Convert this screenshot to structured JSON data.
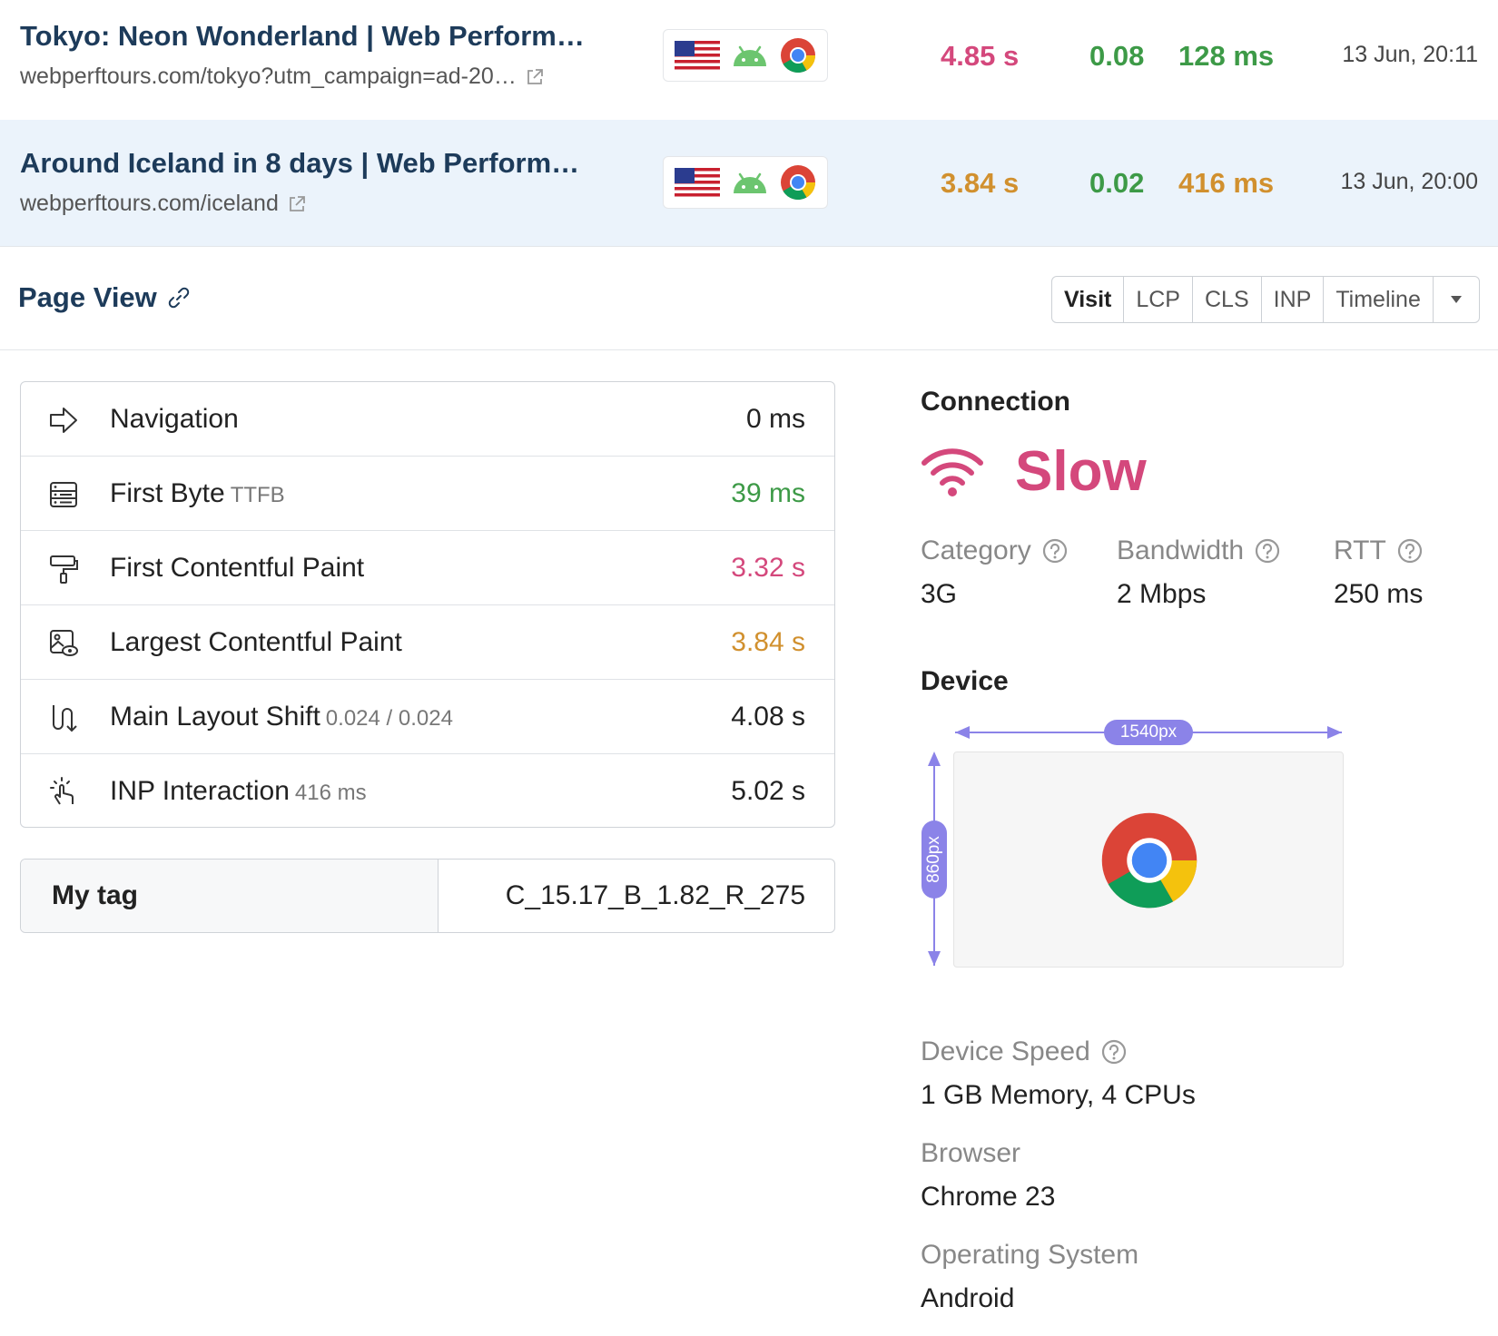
{
  "rows": [
    {
      "title": "Tokyo: Neon Wonderland | Web Perform…",
      "url": "webperftours.com/tokyo?utm_campaign=ad-20…",
      "lcp": "4.85 s",
      "cls": "0.08",
      "inp": "128 ms",
      "date": "13 Jun, 20:11"
    },
    {
      "title": "Around Iceland in 8 days | Web Perform…",
      "url": "webperftours.com/iceland",
      "lcp": "3.84 s",
      "cls": "0.02",
      "inp": "416 ms",
      "date": "13 Jun, 20:00"
    }
  ],
  "page_view": {
    "title": "Page View",
    "tabs": [
      "Visit",
      "LCP",
      "CLS",
      "INP",
      "Timeline"
    ]
  },
  "metrics": [
    {
      "label": "Navigation",
      "sub": "",
      "value": "0 ms"
    },
    {
      "label": "First Byte",
      "sub": "TTFB",
      "value": "39 ms"
    },
    {
      "label": "First Contentful Paint",
      "sub": "",
      "value": "3.32 s"
    },
    {
      "label": "Largest Contentful Paint",
      "sub": "",
      "value": "3.84 s"
    },
    {
      "label": "Main Layout Shift",
      "sub": "0.024 / 0.024",
      "value": "4.08 s"
    },
    {
      "label": "INP Interaction",
      "sub": "416 ms",
      "value": "5.02 s"
    }
  ],
  "tag": {
    "key": "My tag",
    "value": "C_15.17_B_1.82_R_275"
  },
  "connection": {
    "title": "Connection",
    "status": "Slow",
    "category_label": "Category",
    "category_value": "3G",
    "bandwidth_label": "Bandwidth",
    "bandwidth_value": "2 Mbps",
    "rtt_label": "RTT",
    "rtt_value": "250 ms"
  },
  "device": {
    "title": "Device",
    "width_label": "1540px",
    "height_label": "860px",
    "speed_label": "Device Speed",
    "speed_value": "1 GB Memory, 4 CPUs",
    "browser_label": "Browser",
    "browser_value": "Chrome 23",
    "os_label": "Operating System",
    "os_value": "Android"
  },
  "colors": {
    "poor": "#d4487c",
    "needs_improvement": "#d1902e",
    "good": "#3d9a47",
    "title": "#1d3b5a",
    "accent": "#8b83e8"
  }
}
